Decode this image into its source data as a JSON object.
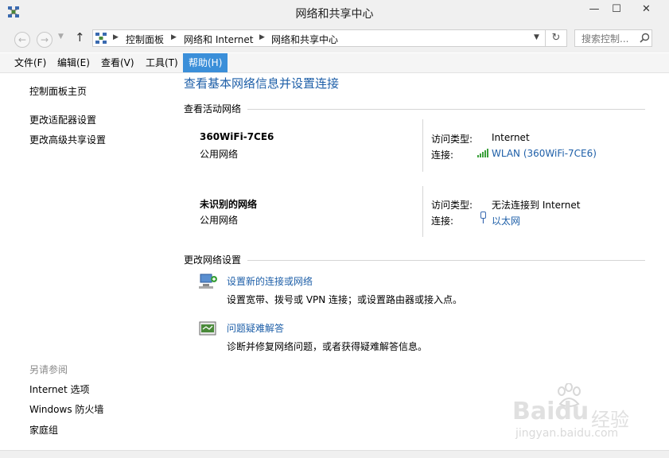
{
  "window": {
    "title": "网络和共享中心",
    "minimize_glyph": "—",
    "maximize_glyph": "☐",
    "close_glyph": "✕"
  },
  "nav": {
    "back_glyph": "←",
    "forward_glyph": "→",
    "dropdown_glyph": "▼",
    "up_glyph": "↑",
    "breadcrumbs": [
      "控制面板",
      "网络和 Internet",
      "网络和共享中心"
    ],
    "separator_glyph": "▶",
    "refresh_glyph": "↻",
    "search_placeholder": "搜索控制..."
  },
  "menu": {
    "items": [
      "文件(F)",
      "编辑(E)",
      "查看(V)",
      "工具(T)",
      "帮助(H)"
    ],
    "active_index": 4,
    "active_color": "#3b8fd9"
  },
  "sidebar": {
    "home": "控制面板主页",
    "links": [
      "更改适配器设置",
      "更改高级共享设置"
    ],
    "see_also_title": "另请参阅",
    "see_also": [
      "Internet 选项",
      "Windows 防火墙",
      "家庭组"
    ]
  },
  "main": {
    "title": "查看基本网络信息并设置连接",
    "active_networks_heading": "查看活动网络",
    "access_type_label": "访问类型:",
    "connection_label": "连接:",
    "networks": [
      {
        "name": "360WiFi-7CE6",
        "category": "公用网络",
        "access_type": "Internet",
        "connection": "WLAN (360WiFi-7CE6)",
        "connection_icon": "wifi-signal-icon"
      },
      {
        "name": "未识别的网络",
        "category": "公用网络",
        "access_type": "无法连接到 Internet",
        "connection": "以太网",
        "connection_icon": "ethernet-plug-icon"
      }
    ],
    "change_settings_heading": "更改网络设置",
    "tasks": [
      {
        "link": "设置新的连接或网络",
        "desc": "设置宽带、拨号或 VPN 连接；或设置路由器或接入点。",
        "icon": "new-connection-icon"
      },
      {
        "link": "问题疑难解答",
        "desc": "诊断并修复网络问题，或者获得疑难解答信息。",
        "icon": "troubleshoot-icon"
      }
    ],
    "link_color": "#1e5fa8"
  },
  "watermark": {
    "brand": "Bai",
    "brand2": "du",
    "cn": "经验",
    "url": "jingyan.baidu.com"
  }
}
